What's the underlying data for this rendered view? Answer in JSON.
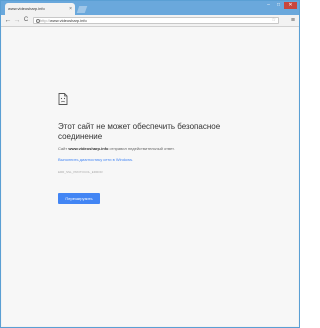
{
  "tab": {
    "title": "www.videosharp.info",
    "close_glyph": "×"
  },
  "window_controls": {
    "minimize": "–",
    "maximize": "□",
    "close": "✕"
  },
  "toolbar": {
    "back_glyph": "←",
    "forward_glyph": "→",
    "reload_glyph": "C",
    "url_scheme": "http://",
    "url_host": "www.videosharp.info",
    "star_glyph": "☆",
    "menu_glyph": "≡"
  },
  "error": {
    "title": "Этот сайт не может обеспечить безопасное соединение",
    "desc_prefix": "Сайт ",
    "desc_host": "www.videosharp.info",
    "desc_suffix": " отправил недействительный ответ.",
    "diagnostics_link": "Выполнить диагностику сети в Windows.",
    "error_code": "ERR_SSL_PROTOCOL_ERROR",
    "reload_label": "Перезагрузить"
  },
  "colors": {
    "accent": "#4285f4",
    "frame": "#6aa8dc",
    "close": "#c9463d"
  },
  "icons": {
    "page": "sad-page-icon"
  }
}
